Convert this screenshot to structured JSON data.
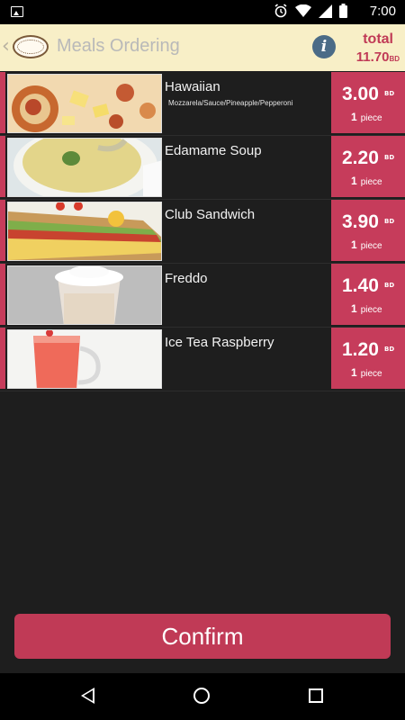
{
  "status_bar": {
    "time": "7:00",
    "icons": [
      "gallery-icon",
      "alarm-icon",
      "wifi-icon",
      "cell-signal-icon",
      "battery-icon"
    ]
  },
  "header": {
    "title": "Meals Ordering",
    "total_label": "total",
    "total_value": "11.70",
    "currency": "BD",
    "info_glyph": "i"
  },
  "items": [
    {
      "name": "Hawaiian",
      "description": "Mozzarela/Sauce/Pineapple/Pepperoni",
      "price": "3.00",
      "currency": "BD",
      "qty": "1",
      "qty_unit": "piece"
    },
    {
      "name": "Edamame Soup",
      "description": "",
      "price": "2.20",
      "currency": "BD",
      "qty": "1",
      "qty_unit": "piece"
    },
    {
      "name": "Club Sandwich",
      "description": "",
      "price": "3.90",
      "currency": "BD",
      "qty": "1",
      "qty_unit": "piece"
    },
    {
      "name": "Freddo",
      "description": "",
      "price": "1.40",
      "currency": "BD",
      "qty": "1",
      "qty_unit": "piece"
    },
    {
      "name": "Ice Tea Raspberry",
      "description": "",
      "price": "1.20",
      "currency": "BD",
      "qty": "1",
      "qty_unit": "piece"
    }
  ],
  "confirm_label": "Confirm",
  "colors": {
    "accent": "#c63c5b",
    "header_bg": "#f8efc7",
    "list_bg": "#1e1e1e"
  }
}
